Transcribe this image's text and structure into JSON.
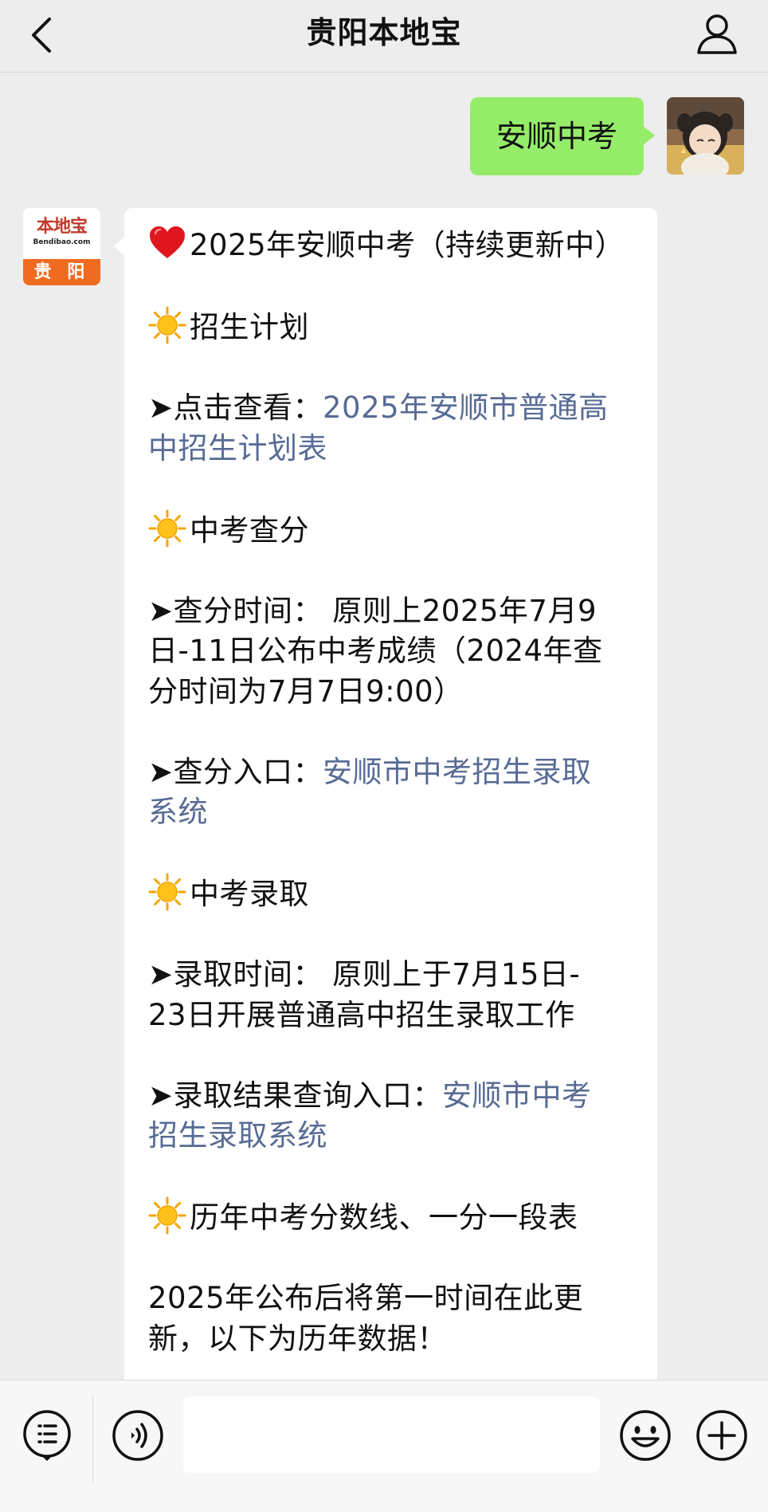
{
  "navbar": {
    "title": "贵阳本地宝",
    "back_icon": "chevron-left-icon",
    "profile_icon": "person-icon"
  },
  "chat": {
    "user_message": "安顺中考",
    "bot_avatar": {
      "brand": "本地宝",
      "url": "Bendibao.com",
      "city": "贵 阳"
    },
    "bot_message": {
      "title": {
        "emoji": "heart-icon",
        "text": "2025年安顺中考（持续更新中）"
      },
      "sections": [
        {
          "heading": {
            "emoji": "sun-icon",
            "text": "招生计划"
          },
          "items": [
            {
              "label": "➤点击查看：",
              "link_line1": "2025年安顺市普通高",
              "link_line2": "中招生计划表"
            }
          ]
        },
        {
          "heading": {
            "emoji": "sun-icon",
            "text": "中考查分"
          },
          "items": [
            {
              "line1": "➤查分时间：  原则上2025年7月9",
              "line2": "日-11日公布中考成绩（2024年查",
              "line3": "分时间为7月7日9:00）"
            },
            {
              "label": "➤查分入口：",
              "link_line1": "安顺市中考招生录取",
              "link_line2": "系统"
            }
          ]
        },
        {
          "heading": {
            "emoji": "sun-icon",
            "text": "中考录取"
          },
          "items": [
            {
              "line1": "➤录取时间：  原则上于7月15日-",
              "line2": "23日开展普通高中招生录取工作"
            },
            {
              "label": "➤录取结果查询入口：",
              "link_line1": "安顺市中考",
              "link_line2": "招生录取系统"
            }
          ]
        },
        {
          "heading": {
            "emoji": "sun-icon",
            "text": "历年中考分数线、一分一段表"
          },
          "items": [
            {
              "line1": "2025年公布后将第一时间在此更",
              "line2": "新，以下为历年数据！"
            }
          ]
        }
      ]
    }
  },
  "inputbar": {
    "menu_icon": "list-menu-icon",
    "voice_icon": "voice-icon",
    "emoji_icon": "smiley-icon",
    "plus_icon": "plus-icon",
    "input_value": ""
  },
  "colors": {
    "link": "#576b95",
    "user_bubble": "#95ec69",
    "background": "#ededed"
  }
}
